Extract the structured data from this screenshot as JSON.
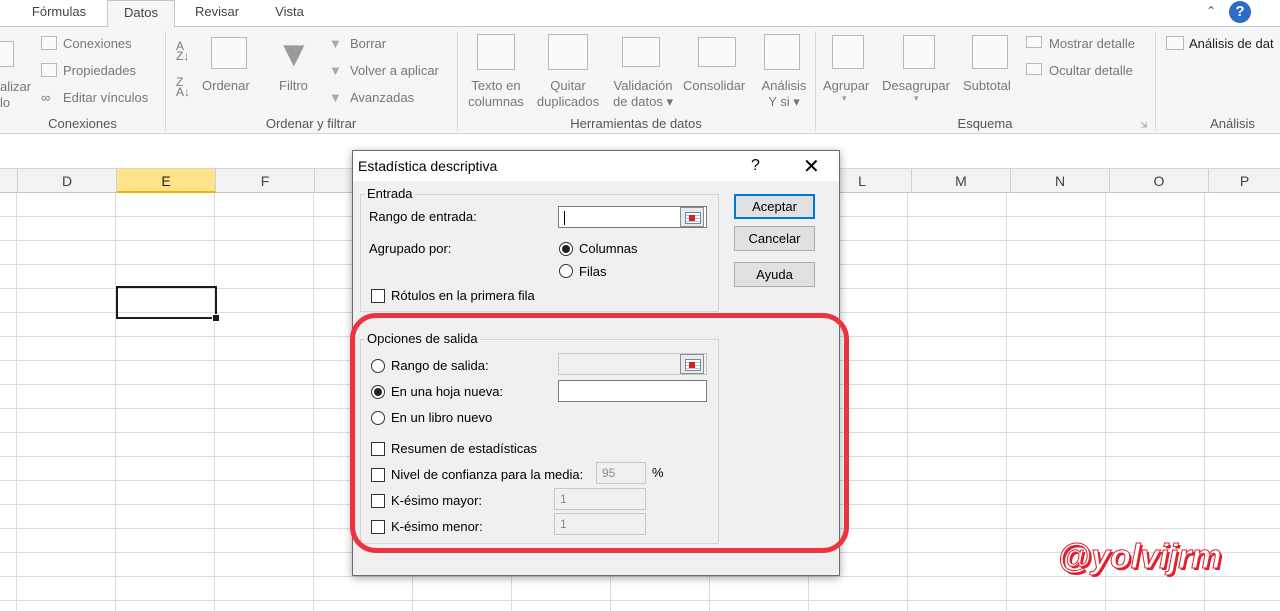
{
  "tabs": [
    "Fórmulas",
    "Datos",
    "Revisar",
    "Vista"
  ],
  "ribbon": {
    "conexiones": {
      "actualizar_frag1": "alizar",
      "actualizar_frag2": "lo",
      "conexiones": "Conexiones",
      "propiedades": "Propiedades",
      "editar_vinculos": "Editar vínculos",
      "group": "Conexiones"
    },
    "ordenar": {
      "ordenar": "Ordenar",
      "filtro": "Filtro",
      "borrar": "Borrar",
      "volver": "Volver a aplicar",
      "avanzadas": "Avanzadas",
      "group": "Ordenar y filtrar"
    },
    "herramientas": {
      "texto": "Texto en",
      "columnas": "columnas",
      "quitar": "Quitar",
      "duplicados": "duplicados",
      "validacion": "Validación",
      "de_datos": "de datos",
      "consolidar": "Consolidar",
      "analisis": "Análisis",
      "ysi": "Y si",
      "group": "Herramientas de datos"
    },
    "esquema": {
      "agrupar": "Agrupar",
      "desagrupar": "Desagrupar",
      "subtotal": "Subtotal",
      "mostrar": "Mostrar detalle",
      "ocultar": "Ocultar detalle",
      "group": "Esquema"
    },
    "analisis": {
      "btn": "Análisis de dat",
      "group": "Análisis"
    }
  },
  "columns": [
    "D",
    "E",
    "F",
    "L",
    "M",
    "N",
    "O",
    "P"
  ],
  "dialog": {
    "title": "Estadística descriptiva",
    "help": "?",
    "close": "✕",
    "entrada": {
      "legend": "Entrada",
      "rango": "Rango de entrada:",
      "agrupado": "Agrupado por:",
      "columnas": "Columnas",
      "filas": "Filas",
      "rotulos": "Rótulos en la primera fila"
    },
    "salida": {
      "legend": "Opciones de salida",
      "rango_salida": "Rango de salida:",
      "hoja_nueva": "En una hoja nueva:",
      "libro_nuevo": "En un libro nuevo",
      "resumen": "Resumen de estadísticas",
      "nivel": "Nivel de confianza para la media:",
      "nivel_valor": "95",
      "pct": "%",
      "kmayor": "K-ésimo mayor:",
      "kmayor_valor": "1",
      "kmenor": "K-ésimo menor:",
      "kmenor_valor": "1"
    },
    "buttons": {
      "aceptar": "Aceptar",
      "cancelar": "Cancelar",
      "ayuda": "Ayuda"
    }
  },
  "watermark": "@yolvijrm",
  "colors": {
    "highlight": "#ee3340",
    "selected_col": "#ffe38a",
    "accent": "#0078d7"
  }
}
